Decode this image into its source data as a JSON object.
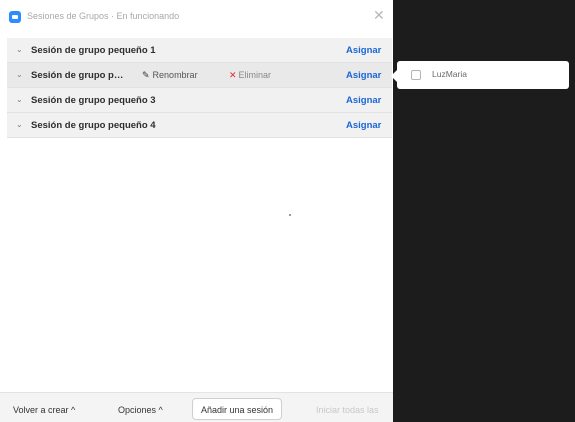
{
  "window": {
    "title": "Sesiones de Grupos · En funcionando",
    "close_symbol": "✕"
  },
  "rooms": [
    {
      "name": "Sesión de grupo pequeño 1",
      "assign_label": "Asignar",
      "caret": "⌄"
    },
    {
      "name": "Sesión de grupo p…",
      "assign_label": "Asignar",
      "caret": "⌄",
      "rename_label": "Renombrar",
      "delete_label": "Eliminar"
    },
    {
      "name": "Sesión de grupo pequeño 3",
      "assign_label": "Asignar",
      "caret": "⌄"
    },
    {
      "name": "Sesión de grupo pequeño 4",
      "assign_label": "Asignar",
      "caret": "⌄"
    }
  ],
  "footer": {
    "recreate_label": "Volver a crear ^",
    "options_label": "Opciones ^",
    "add_room_label": "Añadir una sesión",
    "open_all_label": "Iniciar todas las"
  },
  "assign_popup": {
    "participant_name": "LuzMaria",
    "checked": false
  },
  "colors": {
    "accent": "#1a66d6",
    "delete": "#e02828",
    "dark_background": "#1c1c1c"
  }
}
